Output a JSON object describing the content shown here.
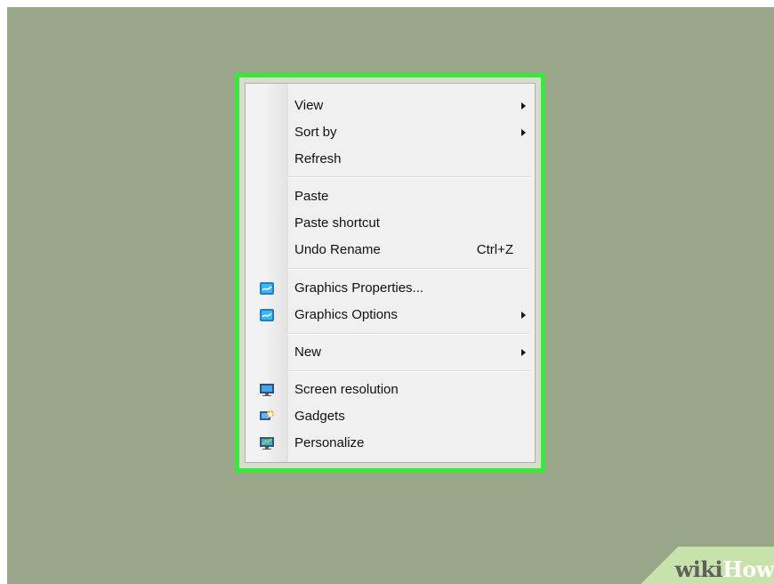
{
  "context_menu": {
    "items": [
      {
        "label": "View",
        "shortcut": "",
        "has_submenu": true,
        "icon": ""
      },
      {
        "label": "Sort by",
        "shortcut": "",
        "has_submenu": true,
        "icon": ""
      },
      {
        "label": "Refresh",
        "shortcut": "",
        "has_submenu": false,
        "icon": ""
      },
      {
        "label": "Paste",
        "shortcut": "",
        "has_submenu": false,
        "icon": ""
      },
      {
        "label": "Paste shortcut",
        "shortcut": "",
        "has_submenu": false,
        "icon": ""
      },
      {
        "label": "Undo Rename",
        "shortcut": "Ctrl+Z",
        "has_submenu": false,
        "icon": ""
      },
      {
        "label": "Graphics Properties...",
        "shortcut": "",
        "has_submenu": false,
        "icon": "graphics-properties-icon"
      },
      {
        "label": "Graphics Options",
        "shortcut": "",
        "has_submenu": true,
        "icon": "graphics-options-icon"
      },
      {
        "label": "New",
        "shortcut": "",
        "has_submenu": true,
        "icon": ""
      },
      {
        "label": "Screen resolution",
        "shortcut": "",
        "has_submenu": false,
        "icon": "screen-resolution-icon"
      },
      {
        "label": "Gadgets",
        "shortcut": "",
        "has_submenu": false,
        "icon": "gadgets-icon"
      },
      {
        "label": "Personalize",
        "shortcut": "",
        "has_submenu": false,
        "icon": "personalize-icon"
      }
    ]
  },
  "watermark": {
    "wiki": "wiki",
    "how": "How"
  },
  "colors": {
    "desktop_background": "#99a689",
    "highlight_border": "#38e83a",
    "menu_background": "#f0f0f0",
    "text": "#111111"
  }
}
